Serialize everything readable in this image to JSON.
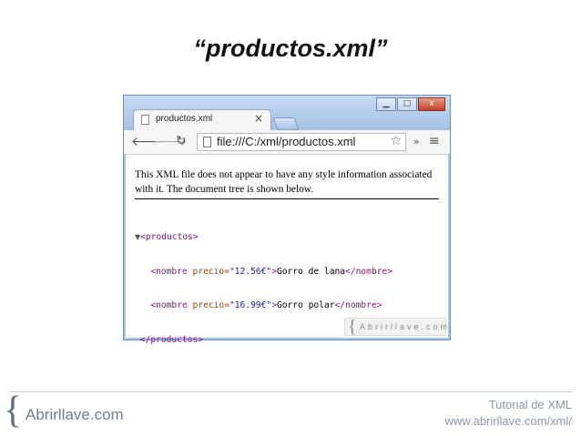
{
  "slide": {
    "title": "“productos.xml”"
  },
  "browser": {
    "tab_label": "productos.xml",
    "tab_close": "×",
    "url": "file:///C:/xml/productos.xml",
    "window_controls": {
      "minimize": "▁",
      "maximize": "□",
      "close": "x"
    },
    "icons": {
      "back": "back-arrow-icon",
      "forward": "forward-arrow-icon",
      "reload": "reload-icon",
      "bookmark": "star-icon",
      "extensions": "double-chevron-icon",
      "menu": "hamburger-menu-icon"
    }
  },
  "page": {
    "notice": "This XML file does not appear to have any style information associated with it. The document tree is shown below.",
    "xml": {
      "root_open": "<productos>",
      "items": [
        {
          "open": "<nombre ",
          "attr": "precio=",
          "value": "\"12.56€\"",
          "close_bracket": ">",
          "text": "Gorro de lana",
          "end": "</nombre>"
        },
        {
          "open": "<nombre ",
          "attr": "precio=",
          "value": "\"16.99€\"",
          "close_bracket": ">",
          "text": "Gorro polar",
          "end": "</nombre>"
        }
      ],
      "root_close": "</productos>",
      "toggle": "▼"
    },
    "watermark": {
      "brace": "{",
      "text": "Abrirllave.com"
    }
  },
  "footer": {
    "logo_brace": "{",
    "logo_text": "Abrirllave.com",
    "line1": "Tutorial de XML",
    "line2": "www.abrirllave.com/xml/"
  },
  "colors": {
    "xml_tag": "#881280",
    "xml_attr": "#994500",
    "xml_value": "#1a1aa6",
    "window_frame": "#a9c5e8"
  }
}
